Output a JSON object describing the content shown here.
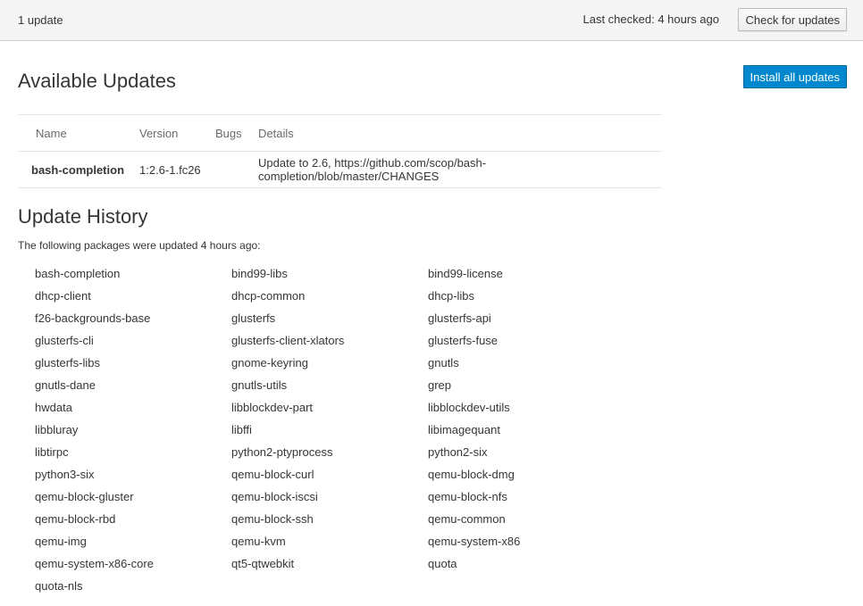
{
  "header": {
    "update_count": "1 update",
    "last_checked": "Last checked: 4 hours ago",
    "check_button": "Check for updates"
  },
  "available": {
    "title": "Available Updates",
    "install_button": "Install all updates",
    "columns": {
      "name": "Name",
      "version": "Version",
      "bugs": "Bugs",
      "details": "Details"
    },
    "rows": [
      {
        "name": "bash-completion",
        "version": "1:2.6-1.fc26",
        "bugs": "",
        "details": "Update to 2.6, https://github.com/scop/bash-completion/blob/master/CHANGES"
      }
    ]
  },
  "history": {
    "title": "Update History",
    "description": "The following packages were updated 4 hours ago:",
    "packages": [
      "bash-completion",
      "bind99-libs",
      "bind99-license",
      "dhcp-client",
      "dhcp-common",
      "dhcp-libs",
      "f26-backgrounds-base",
      "glusterfs",
      "glusterfs-api",
      "glusterfs-cli",
      "glusterfs-client-xlators",
      "glusterfs-fuse",
      "glusterfs-libs",
      "gnome-keyring",
      "gnutls",
      "gnutls-dane",
      "gnutls-utils",
      "grep",
      "hwdata",
      "libblockdev-part",
      "libblockdev-utils",
      "libbluray",
      "libffi",
      "libimagequant",
      "libtirpc",
      "python2-ptyprocess",
      "python2-six",
      "python3-six",
      "qemu-block-curl",
      "qemu-block-dmg",
      "qemu-block-gluster",
      "qemu-block-iscsi",
      "qemu-block-nfs",
      "qemu-block-rbd",
      "qemu-block-ssh",
      "qemu-common",
      "qemu-img",
      "qemu-kvm",
      "qemu-system-x86",
      "qemu-system-x86-core",
      "qt5-qtwebkit",
      "quota",
      "quota-nls"
    ]
  }
}
